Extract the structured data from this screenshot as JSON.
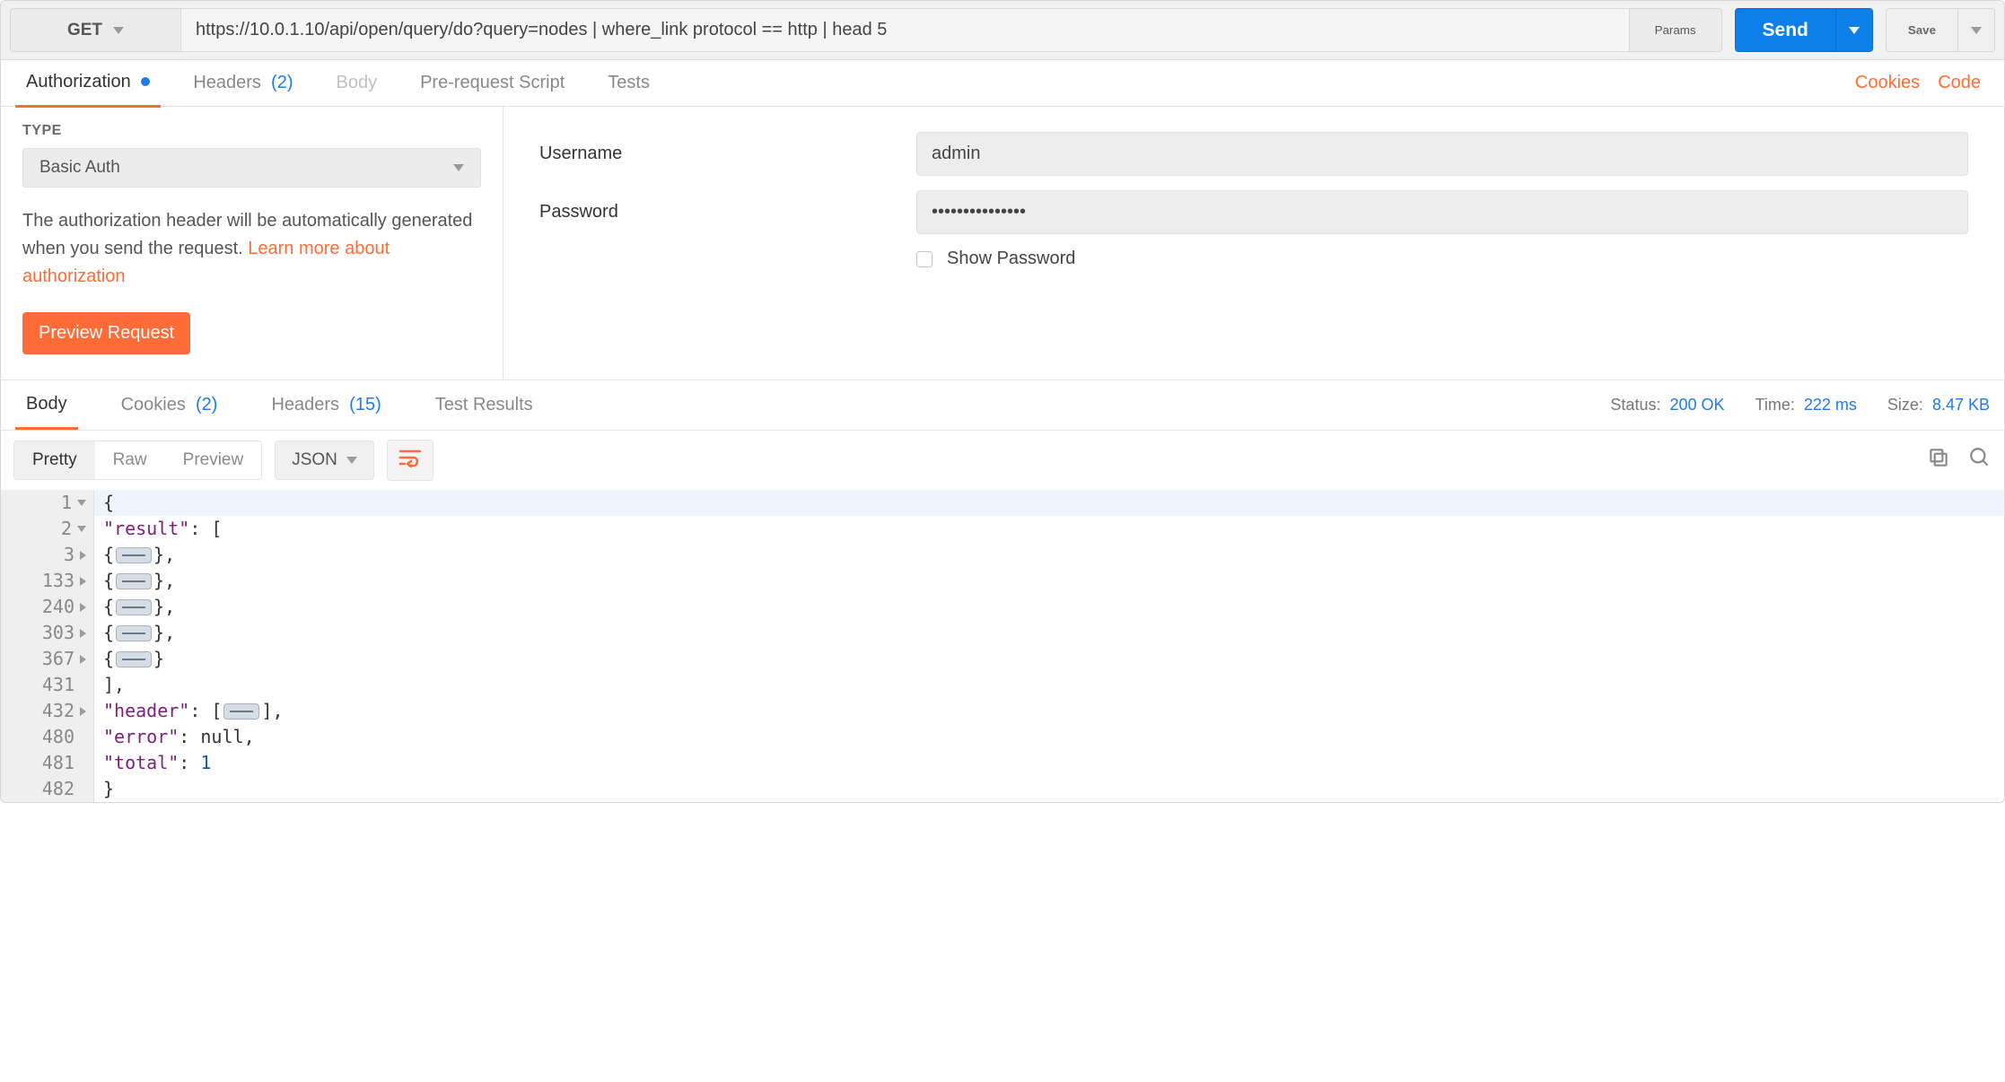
{
  "request": {
    "method": "GET",
    "url": "https://10.0.1.10/api/open/query/do?query=nodes | where_link protocol == http | head 5",
    "params_btn": "Params",
    "send": "Send",
    "save": "Save"
  },
  "req_tabs": {
    "authorization": "Authorization",
    "headers": "Headers",
    "headers_count": "(2)",
    "body": "Body",
    "pre_request": "Pre-request Script",
    "tests": "Tests",
    "cookies_link": "Cookies",
    "code_link": "Code"
  },
  "auth": {
    "type_label": "TYPE",
    "type_value": "Basic Auth",
    "desc_a": "The authorization header will be automatically generated when you send the request. ",
    "desc_link": "Learn more about authorization",
    "preview_btn": "Preview Request",
    "username_label": "Username",
    "username_value": "admin",
    "password_label": "Password",
    "password_value": "•••••••••••••••",
    "show_password": "Show Password"
  },
  "res_tabs": {
    "body": "Body",
    "cookies": "Cookies",
    "cookies_count": "(2)",
    "headers": "Headers",
    "headers_count": "(15)",
    "test_results": "Test Results"
  },
  "res_meta": {
    "status_label": "Status:",
    "status_value": "200 OK",
    "time_label": "Time:",
    "time_value": "222 ms",
    "size_label": "Size:",
    "size_value": "8.47 KB"
  },
  "res_tools": {
    "pretty": "Pretty",
    "raw": "Raw",
    "preview": "Preview",
    "format": "JSON"
  },
  "response_json": {
    "line_numbers": [
      "1",
      "2",
      "3",
      "133",
      "240",
      "303",
      "367",
      "431",
      "432",
      "480",
      "481",
      "482"
    ],
    "folds": [
      "down",
      "down",
      "right",
      "right",
      "right",
      "right",
      "right",
      "",
      "right",
      "",
      "",
      ""
    ],
    "result_key": "\"result\"",
    "header_key": "\"header\"",
    "error_key": "\"error\"",
    "error_val": "null",
    "total_key": "\"total\"",
    "total_val": "1"
  }
}
